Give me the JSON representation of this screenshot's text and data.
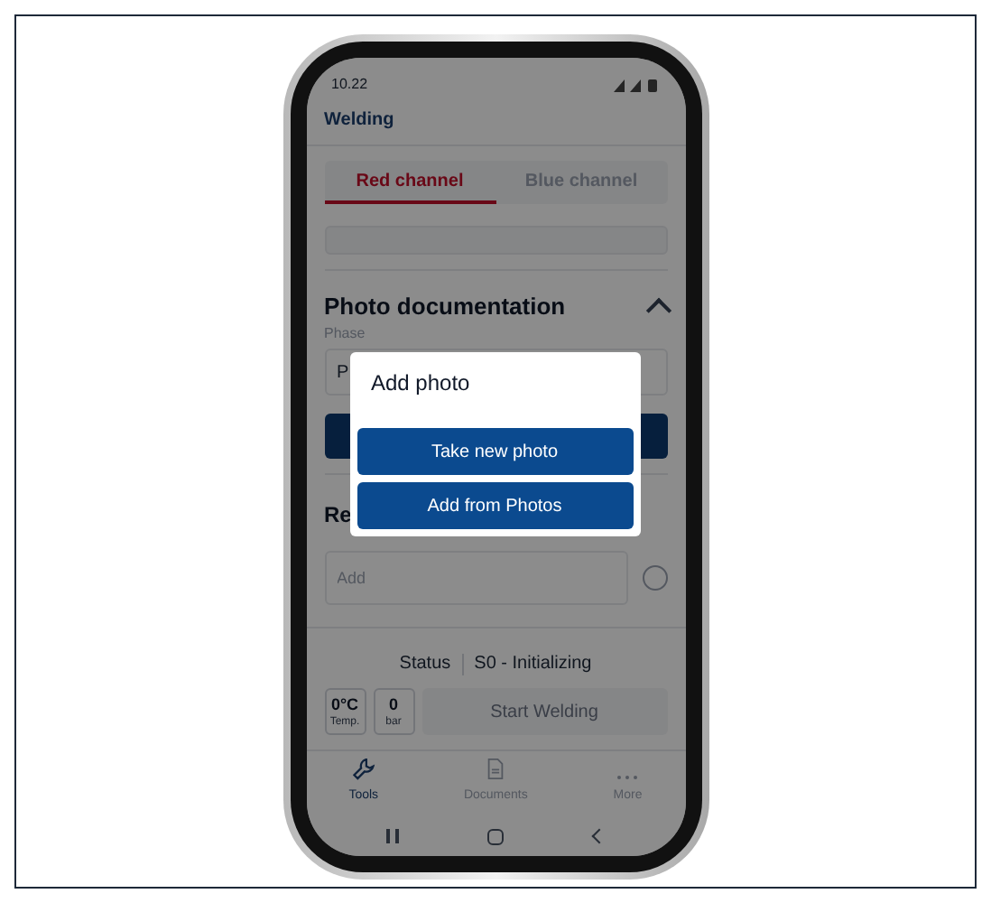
{
  "status_bar": {
    "time": "10.22"
  },
  "header": {
    "title": "Welding"
  },
  "tabs": [
    {
      "label": "Red channel",
      "selected": true
    },
    {
      "label": "Blue channel",
      "selected": false
    }
  ],
  "photo_section": {
    "title": "Photo documentation",
    "expanded": true,
    "phase_label": "Phase",
    "phase_value": "P"
  },
  "second_section": {
    "title": "Re",
    "add_placeholder": "Add"
  },
  "status": {
    "label": "Status",
    "value": "S0 - Initializing"
  },
  "readings": [
    {
      "value": "0°C",
      "unit": "Temp."
    },
    {
      "value": "0",
      "unit": "bar"
    }
  ],
  "start_button": {
    "label": "Start Welding",
    "disabled": true
  },
  "bottom_nav": [
    {
      "label": "Tools",
      "selected": true
    },
    {
      "label": "Documents",
      "selected": false
    },
    {
      "label": "More",
      "selected": false
    }
  ],
  "dialog": {
    "title": "Add photo",
    "buttons": [
      "Take new photo",
      "Add from Photos"
    ]
  }
}
